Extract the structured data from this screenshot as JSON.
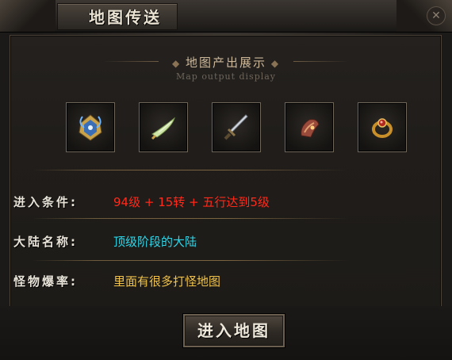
{
  "window": {
    "title": "地图传送"
  },
  "section": {
    "title": "地图产出展示",
    "subtitle": "Map output display"
  },
  "items": [
    {
      "icon": "winged-crest-icon"
    },
    {
      "icon": "jade-blade-icon"
    },
    {
      "icon": "sword-icon"
    },
    {
      "icon": "bracer-icon"
    },
    {
      "icon": "ring-icon"
    }
  ],
  "info": {
    "condition_label": "进入条件:",
    "condition_value": "94级 + 15转  + 五行达到5级",
    "continent_label": "大陆名称:",
    "continent_value": "顶级阶段的大陆",
    "drop_label": "怪物爆率:",
    "drop_value": "里面有很多打怪地图"
  },
  "button": {
    "enter_label": "进入地图"
  },
  "colors": {
    "condition": "#ff2a1a",
    "continent": "#2fd6e8",
    "drop": "#f0c24a"
  }
}
